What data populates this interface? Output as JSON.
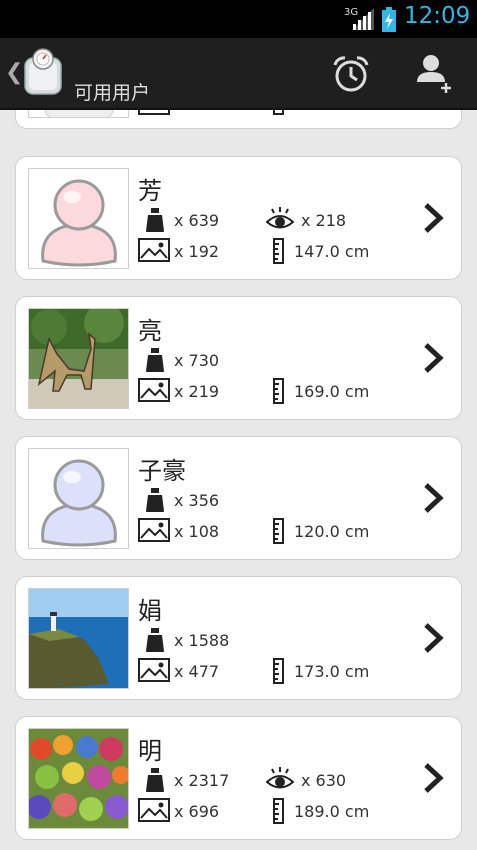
{
  "status_bar": {
    "network": "3G",
    "time": "12:09"
  },
  "action_bar": {
    "title": "可用用户"
  },
  "users": [
    {
      "name": "芳",
      "weight_count": "x 639",
      "views": "x 218",
      "photos": "x 192",
      "height": "147.0 cm",
      "photo": "pink-avatar"
    },
    {
      "name": "亮",
      "weight_count": "x 730",
      "photos": "x 219",
      "height": "169.0 cm",
      "photo": "sculpture-garden"
    },
    {
      "name": "子豪",
      "weight_count": "x 356",
      "photos": "x 108",
      "height": "120.0 cm",
      "photo": "lavender-avatar"
    },
    {
      "name": "娟",
      "weight_count": "x 1588",
      "photos": "x 477",
      "height": "173.0 cm",
      "photo": "lighthouse-coast"
    },
    {
      "name": "明",
      "weight_count": "x 2317",
      "views": "x 630",
      "photos": "x 696",
      "height": "189.0 cm",
      "photo": "fruit-market"
    }
  ]
}
